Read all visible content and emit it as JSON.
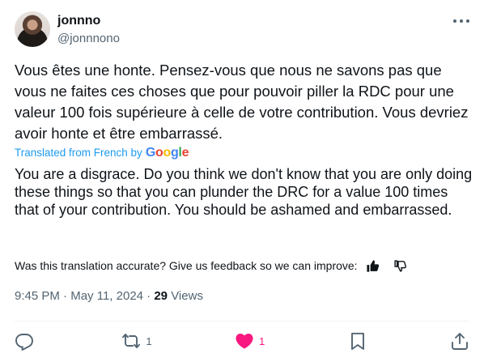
{
  "author": {
    "display_name": "jonnno",
    "handle": "@jonnnono"
  },
  "tweet": {
    "original_text": "Vous êtes une honte. Pensez-vous que nous ne savons pas que vous ne faites ces choses que pour pouvoir piller la RDC pour une valeur 100 fois supérieure à celle de votre contribution. Vous devriez avoir honte et être embarrassé.",
    "translated_by_label": "Translated from French by",
    "translator_brand": "Google",
    "translated_text": "You are a disgrace. Do you think we don't know that you are only doing these things so that you can plunder the DRC for a value 100 times that of your contribution. You should be ashamed and embarrassed.",
    "feedback_prompt": "Was this translation accurate? Give us feedback so we can improve:",
    "time": "9:45 PM",
    "date": "May 11, 2024",
    "separator": "·",
    "views_count": "29",
    "views_label": "Views"
  },
  "actions": {
    "reply_count": "",
    "repost_count": "1",
    "like_count": "1"
  },
  "icons": {
    "more": "more-icon",
    "thumbs_up": "thumbs-up-icon",
    "thumbs_down": "thumbs-down-icon",
    "reply": "reply-icon",
    "repost": "repost-icon",
    "like": "heart-icon",
    "bookmark": "bookmark-icon",
    "share": "share-icon"
  },
  "colors": {
    "text": "#0f1419",
    "secondary": "#536471",
    "link": "#1d9bf0",
    "like": "#f91880"
  }
}
